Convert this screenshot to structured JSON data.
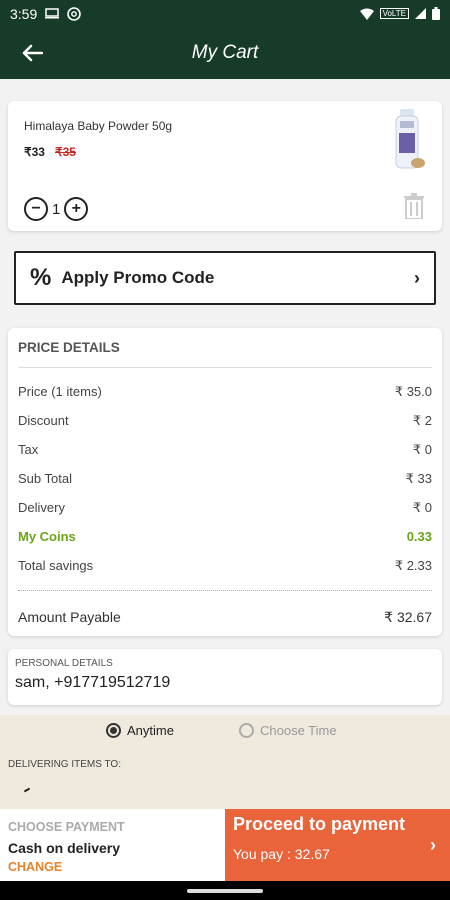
{
  "status": {
    "time": "3:59",
    "network": "VoLTE"
  },
  "header": {
    "title": "My Cart"
  },
  "cart_item": {
    "name": "Himalaya Baby Powder 50g",
    "price": "₹33",
    "mrp": "₹35",
    "quantity": "1"
  },
  "promo": {
    "icon_text": "%",
    "label": "Apply Promo Code"
  },
  "price_details": {
    "title": "PRICE DETAILS",
    "rows": [
      {
        "label": "Price (1 items)",
        "value": "₹ 35.0"
      },
      {
        "label": "Discount",
        "value": "₹ 2"
      },
      {
        "label": "Tax",
        "value": "₹ 0"
      },
      {
        "label": "Sub Total",
        "value": "₹ 33"
      },
      {
        "label": "Delivery",
        "value": "₹ 0"
      },
      {
        "label": "My Coins",
        "value": "0.33"
      },
      {
        "label": "Total savings",
        "value": "₹ 2.33"
      }
    ],
    "total": {
      "label": "Amount Payable",
      "value": "₹ 32.67"
    }
  },
  "personal": {
    "label": "PERSONAL DETAILS",
    "value": "sam, +917719512719"
  },
  "delivery_time": {
    "anytime": "Anytime",
    "choose_time": "Choose Time",
    "selected": "Anytime"
  },
  "delivering_to": {
    "label": "DELIVERING ITEMS TO:"
  },
  "payment": {
    "choose_label": "CHOOSE PAYMENT",
    "method": "Cash on delivery",
    "change": "CHANGE",
    "proceed": "Proceed to payment",
    "you_pay": "You pay : 32.67"
  },
  "colors": {
    "header": "#173b29",
    "accent_orange": "#e9633b",
    "coins_green": "#6aa51a",
    "mrp_red": "#c62828"
  }
}
